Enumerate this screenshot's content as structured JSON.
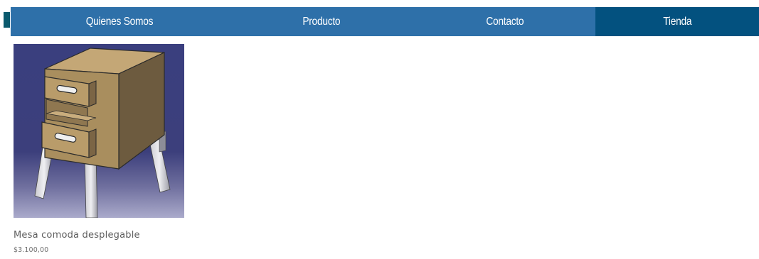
{
  "nav": {
    "items": [
      {
        "label": "Quienes Somos"
      },
      {
        "label": "Producto"
      },
      {
        "label": "Contacto"
      },
      {
        "label": "Tienda",
        "active": true
      }
    ],
    "colors": {
      "bar": "#2e70a9",
      "active": "#03517f",
      "accent": "#0b5a6e",
      "text": "#ffffff"
    }
  },
  "product": {
    "name": "Mesa comoda desplegable",
    "price": "$3.100,00",
    "image_icon": "nightstand-cad-render"
  }
}
